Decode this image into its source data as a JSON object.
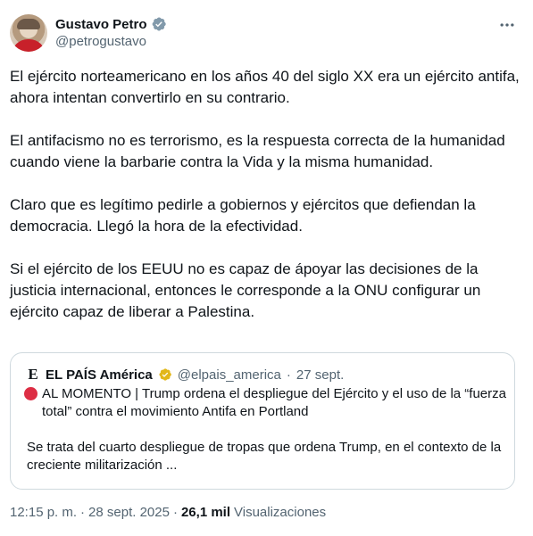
{
  "author": {
    "name": "Gustavo Petro",
    "handle": "@petrogustavo",
    "verified_color": "#829aab"
  },
  "tweet": {
    "paragraphs": [
      "El ejército norteamericano en los años 40 del siglo XX era un ejército antifa, ahora intentan convertirlo en su contrario.",
      "El antifacismo no es terrorismo, es la respuesta correcta de la humanidad cuando viene la barbarie contra la Vida y la misma humanidad.",
      "Claro que es legítimo pedirle a gobiernos y ejércitos que defiendan la democracia. Llegó la hora de la efectividad.",
      "Si el ejército de los EEUU no es capaz de ápoyar las decisiones de la justicia internacional, entonces le corresponde a la ONU configurar un ejército capaz de liberar a Palestina."
    ]
  },
  "quote": {
    "logo_letter": "E",
    "name": "EL PAÍS América",
    "handle": "@elpais_america",
    "separator": "·",
    "date": "27 sept.",
    "badge_color": "#e2b719",
    "line1": "AL MOMENTO | Trump ordena el despliegue del Ejército y el uso de la “fuerza total” contra el movimiento Antifa en Portland",
    "line2": "Se trata del cuarto despliegue de tropas que ordena Trump, en el contexto de la creciente militarización ..."
  },
  "meta": {
    "time": "12:15 p. m.",
    "separator": "·",
    "date": "28 sept. 2025",
    "separator2": "·",
    "views_count": "26,1 mil",
    "views_label": "Visualizaciones"
  }
}
